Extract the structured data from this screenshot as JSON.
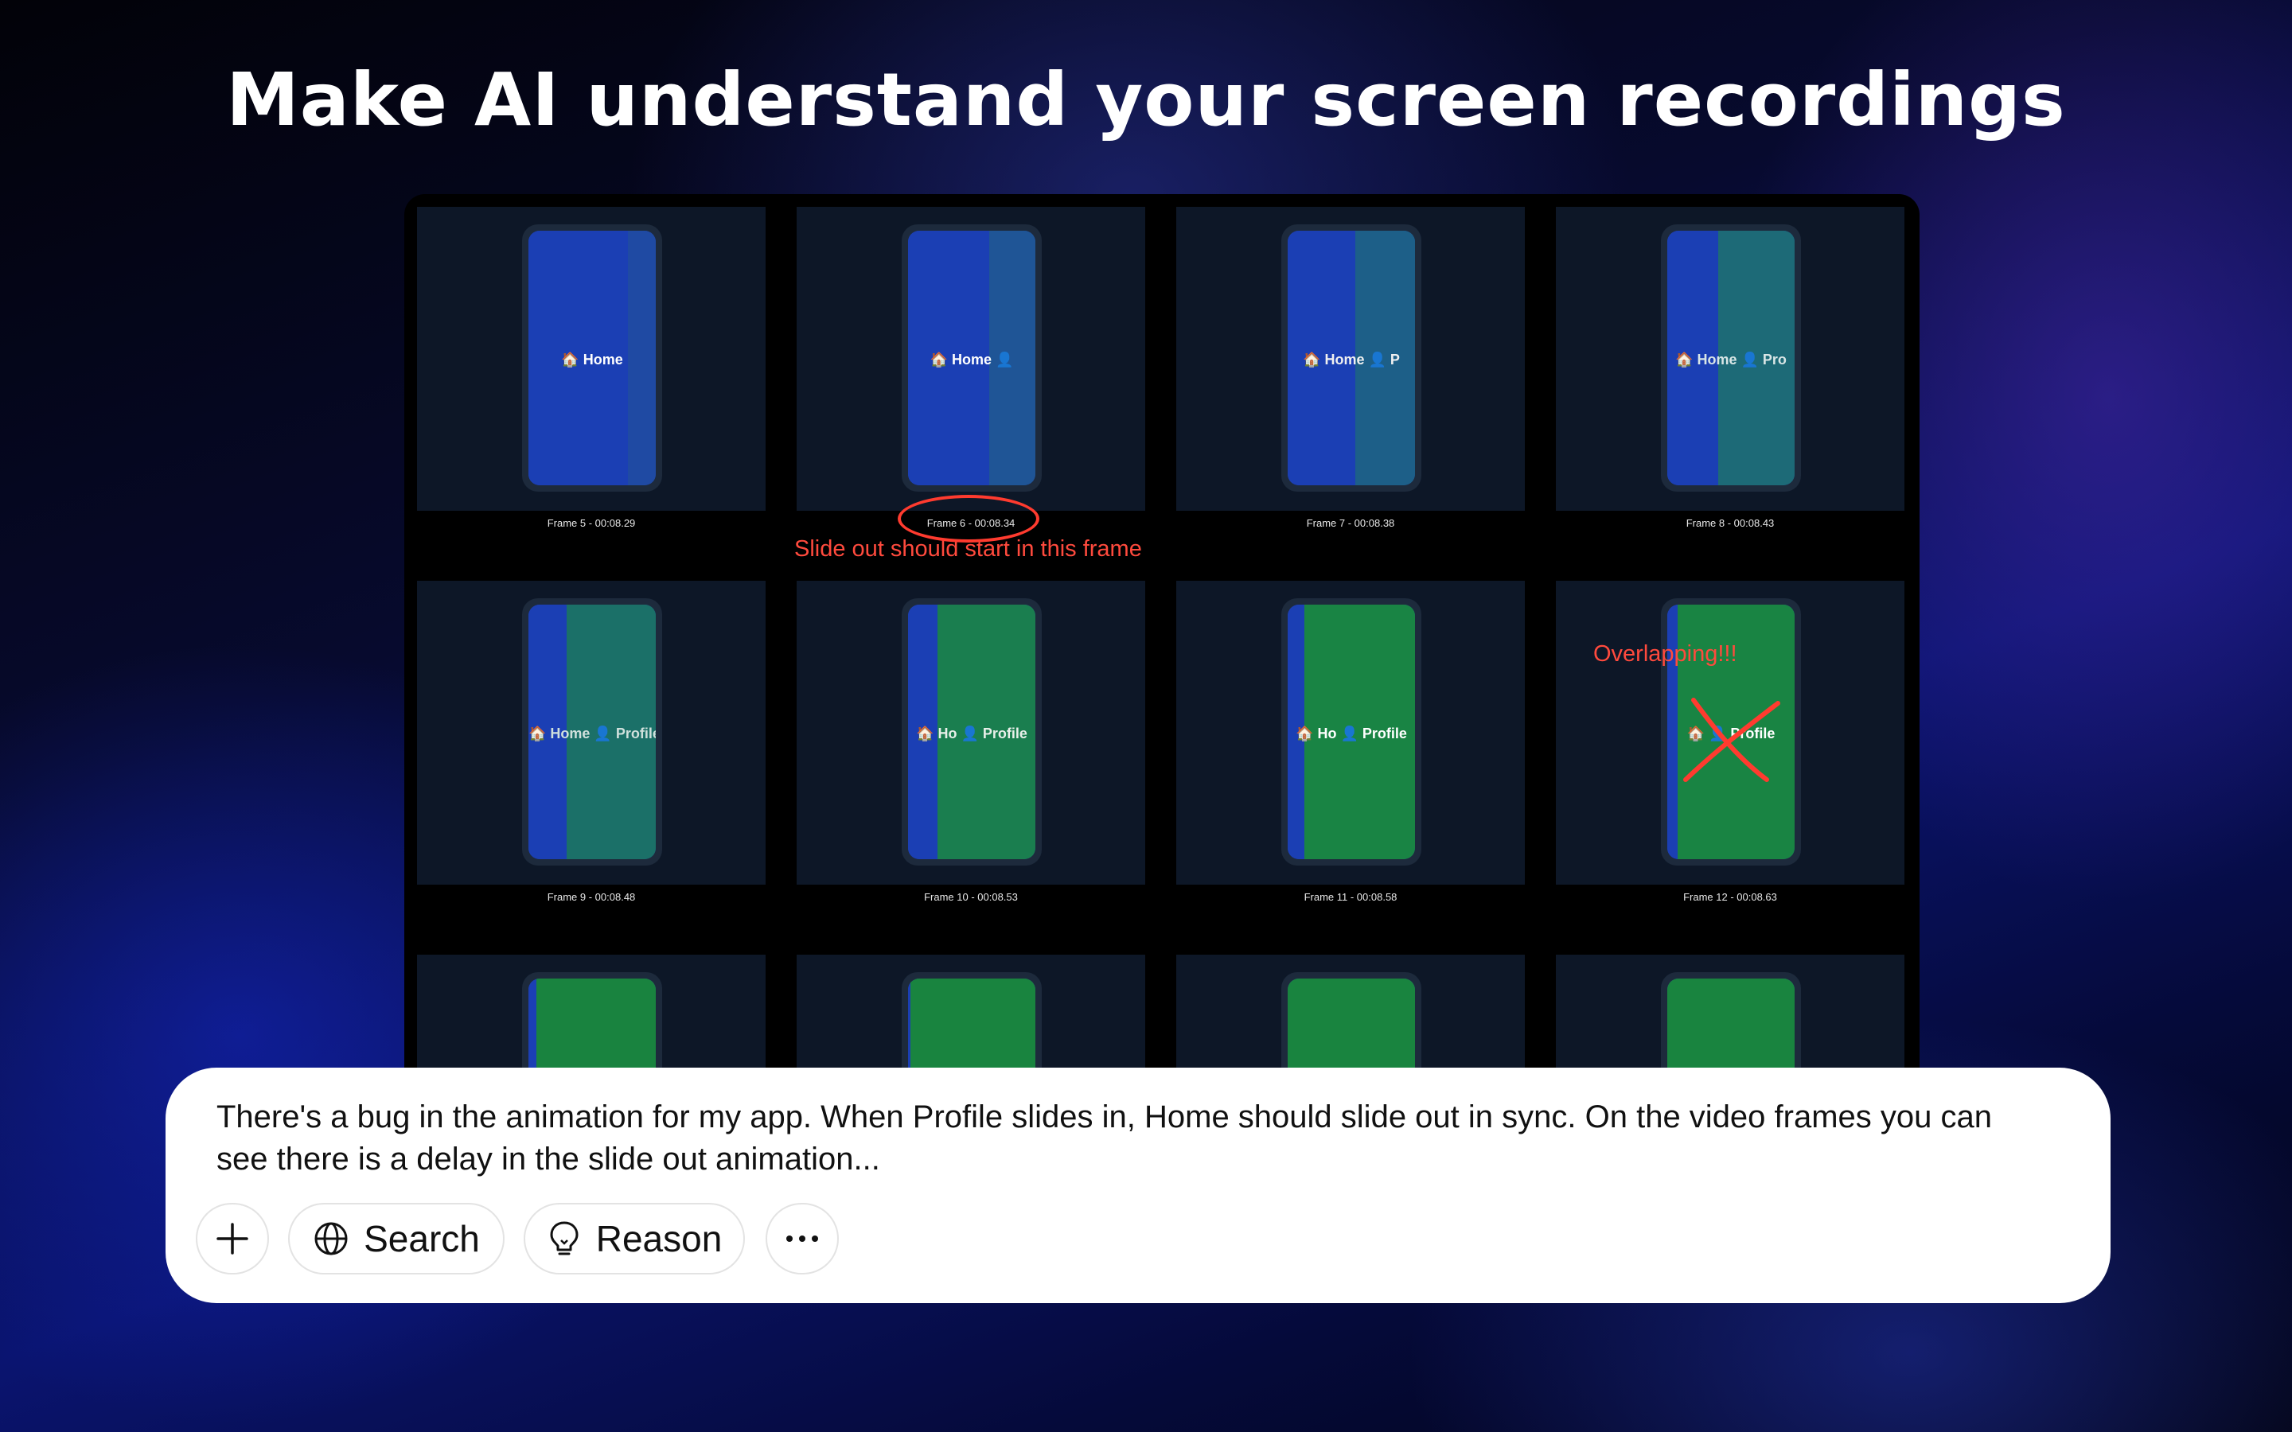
{
  "headline": "Make AI understand your screen recordings",
  "frames": [
    {
      "caption": "Frame 5 - 00:08.29",
      "label": "🏠 Home",
      "blue": 0.78,
      "over": 0.22,
      "overColor": "#1f4aa3",
      "labelColor": "#ffffff"
    },
    {
      "caption": "Frame 6 - 00:08.34",
      "label": "🏠 Home   👤",
      "blue": 0.64,
      "over": 0.36,
      "overColor": "#1f5596",
      "labelColor": "#ffffff"
    },
    {
      "caption": "Frame 7 - 00:08.38",
      "label": "🏠 Home 👤 P",
      "blue": 0.53,
      "over": 0.47,
      "overColor": "#1d5f88",
      "labelColor": "#f0f0f0"
    },
    {
      "caption": "Frame 8 - 00:08.43",
      "label": "🏠 Home 👤 Pro",
      "blue": 0.4,
      "over": 0.6,
      "overColor": "#1d6a77",
      "labelColor": "#d9e6e6"
    },
    {
      "caption": "Frame 9 - 00:08.48",
      "label": "🏠 Home 👤 Profile",
      "blue": 0.3,
      "over": 0.7,
      "overColor": "#1b7068",
      "labelColor": "#cfe0dc"
    },
    {
      "caption": "Frame 10 - 00:08.53",
      "label": "🏠 Ho 👤 Profile",
      "blue": 0.23,
      "over": 0.77,
      "overColor": "#1a7e4f",
      "labelColor": "#e8efe9"
    },
    {
      "caption": "Frame 11 - 00:08.58",
      "label": "🏠 Ho 👤 Profile",
      "blue": 0.13,
      "over": 0.87,
      "overColor": "#198444",
      "labelColor": "#ffffff"
    },
    {
      "caption": "Frame 12 - 00:08.63",
      "label": "🏠 👤 Profile",
      "blue": 0.08,
      "over": 0.92,
      "overColor": "#198443",
      "labelColor": "#ffffff"
    },
    {
      "caption": "",
      "label": "",
      "blue": 0.06,
      "over": 0.94,
      "overColor": "#19833f",
      "labelColor": "#ffffff"
    },
    {
      "caption": "",
      "label": "",
      "blue": 0.02,
      "over": 0.98,
      "overColor": "#19843f",
      "labelColor": "#ffffff"
    },
    {
      "caption": "",
      "label": "",
      "blue": 0.0,
      "over": 1.0,
      "overColor": "#19843f",
      "labelColor": "#ffffff"
    },
    {
      "caption": "",
      "label": "",
      "blue": 0.0,
      "over": 1.0,
      "overColor": "#19843f",
      "labelColor": "#ffffff"
    }
  ],
  "annotations": {
    "slide_out_note": "Slide out should start in this frame",
    "overlap_note": "Overlapping!!!"
  },
  "colors": {
    "annotation": "#ff3b2f",
    "home_blue": "#1b3fb4",
    "profile_green": "#19843f"
  },
  "chat": {
    "message": "There's a bug in the animation for my app. When Profile slides in, Home should slide out in sync.  On the video frames you can see there is a delay in the slide out animation...",
    "add_icon": "plus-icon",
    "search_label": "Search",
    "search_icon": "globe-icon",
    "reason_label": "Reason",
    "reason_icon": "lightbulb-icon",
    "more_icon": "more-icon"
  }
}
